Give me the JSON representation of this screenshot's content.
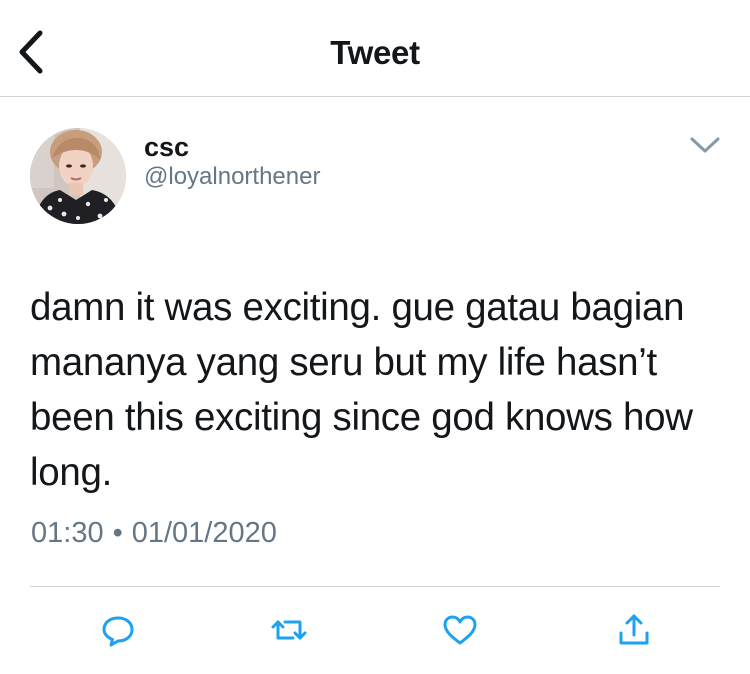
{
  "header": {
    "title": "Tweet",
    "back_icon": "chevron-left-icon"
  },
  "tweet": {
    "author": {
      "display_name": "csc",
      "handle": "@loyalnorthener"
    },
    "text": "damn it was exciting. gue gatau bagian mananya yang seru but my life hasn’t been this exciting since god knows how long.",
    "time": "01:30",
    "separator": "•",
    "date": "01/01/2020"
  },
  "actions": [
    "reply-icon",
    "retweet-icon",
    "like-icon",
    "share-icon"
  ],
  "colors": {
    "text_primary": "#14171a",
    "text_secondary": "#657786",
    "accent": "#1da1f2",
    "divider": "#cfd4d8"
  }
}
